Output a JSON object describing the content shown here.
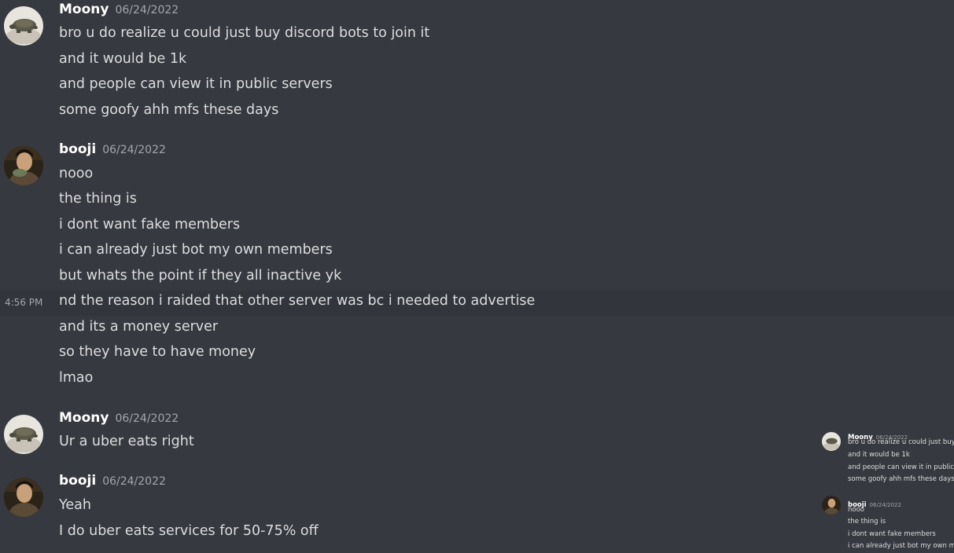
{
  "messages": [
    {
      "username": "Moony",
      "timestamp": "06/24/2022",
      "avatar": "turtle-avatar",
      "lines": [
        "bro u do realize u could just buy discord bots to join it",
        "and it would be 1k",
        "and people can view it in public servers",
        "some goofy ahh mfs these days"
      ]
    },
    {
      "username": "booji",
      "timestamp": "06/24/2022",
      "avatar": "person-avatar",
      "hover_time": "4:56 PM",
      "lines": [
        "nooo",
        "the thing is",
        "i dont want fake members",
        "i can already just bot my own members",
        "but whats the point if they all inactive yk",
        "nd the reason i raided that other server was bc i needed to advertise",
        "and its a money server",
        "so they have to have money",
        "lmao"
      ]
    },
    {
      "username": "Moony",
      "timestamp": "06/24/2022",
      "avatar": "turtle-avatar",
      "lines": [
        "Ur a uber eats right"
      ]
    },
    {
      "username": "booji",
      "timestamp": "06/24/2022",
      "avatar": "person-avatar",
      "lines": [
        "Yeah",
        "I do uber eats services for 50-75% off"
      ]
    }
  ],
  "mini": {
    "groups": [
      {
        "username": "Moony",
        "timestamp": "06/24/2022",
        "lines": [
          "bro u do realize u could just buy di",
          "and it would be 1k",
          "and people can view it in public se",
          "some goofy ahh mfs these days"
        ]
      },
      {
        "username": "booji",
        "timestamp": "06/24/2022",
        "lines": [
          "nooo",
          "the thing is",
          "i dont want fake members",
          "i can already just bot my own mem"
        ]
      }
    ]
  },
  "colors": {
    "background": "#36393f",
    "hover_background": "#32353b",
    "text": "#dcddde",
    "username": "#ffffff",
    "muted": "#a3a6aa"
  }
}
